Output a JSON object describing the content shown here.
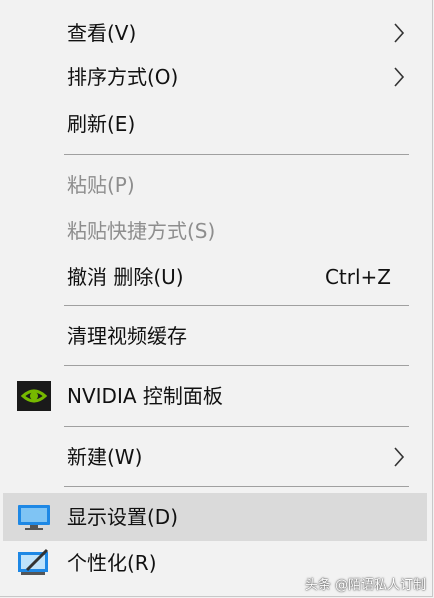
{
  "menu": {
    "items": [
      {
        "label": "查看(V)"
      },
      {
        "label": "排序方式(O)"
      },
      {
        "label": "刷新(E)"
      },
      {
        "label": "粘贴(P)"
      },
      {
        "label": "粘贴快捷方式(S)"
      },
      {
        "label": "撤消 删除(U)",
        "shortcut": "Ctrl+Z"
      },
      {
        "label": "清理视频缓存"
      },
      {
        "label": "NVIDIA 控制面板",
        "icon": "nvidia-icon"
      },
      {
        "label": "新建(W)"
      },
      {
        "label": "显示设置(D)",
        "icon": "display-icon"
      },
      {
        "label": "个性化(R)",
        "icon": "personalize-icon"
      }
    ]
  },
  "watermark": "头条 @陌语私人订制",
  "colors": {
    "menu_bg": "#f2f2f2",
    "hover_bg": "#dadada",
    "separator": "#a0a0a0",
    "disabled_text": "#8e8e8e",
    "nvidia_green": "#76b900"
  }
}
